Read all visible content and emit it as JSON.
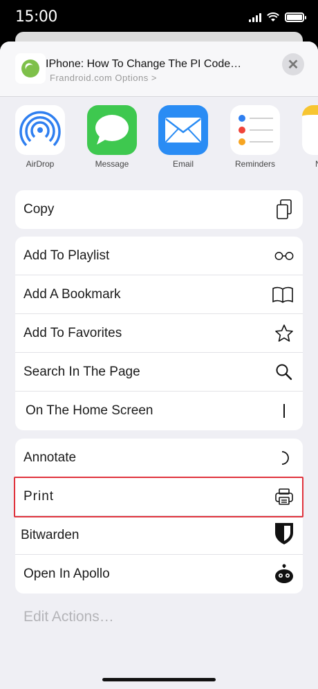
{
  "status_bar": {
    "time": "15:00"
  },
  "header": {
    "title": "IPhone: How To Change The PI Code…",
    "subtitle": "Frandroid.com Options >"
  },
  "apps": [
    {
      "label": "AirDrop",
      "icon": "airdrop-icon"
    },
    {
      "label": "Message",
      "icon": "messages-icon"
    },
    {
      "label": "Email",
      "icon": "mail-icon"
    },
    {
      "label": "Reminders",
      "icon": "reminders-icon"
    },
    {
      "label": "N",
      "icon": "notes-icon"
    }
  ],
  "group1": [
    {
      "label": "Copy",
      "icon": "copy-icon"
    }
  ],
  "group2": [
    {
      "label": "Add To Playlist",
      "icon": "glasses-icon"
    },
    {
      "label": "Add A Bookmark",
      "icon": "book-icon"
    },
    {
      "label": "Add To Favorites",
      "icon": "star-icon"
    },
    {
      "label": "Search In The Page",
      "icon": "search-icon"
    },
    {
      "label": "On The Home Screen",
      "icon": "add-square-icon"
    }
  ],
  "group3": [
    {
      "label": "Annotate",
      "icon": "markup-icon"
    },
    {
      "label": "Print",
      "icon": "printer-icon"
    },
    {
      "label": "Bitwarden",
      "icon": "shield-icon"
    },
    {
      "label": "Open In Apollo",
      "icon": "robot-icon"
    }
  ],
  "edit_actions": "Edit Actions…",
  "colors": {
    "highlight": "#e0323c",
    "sheet_bg": "#efeff4"
  }
}
